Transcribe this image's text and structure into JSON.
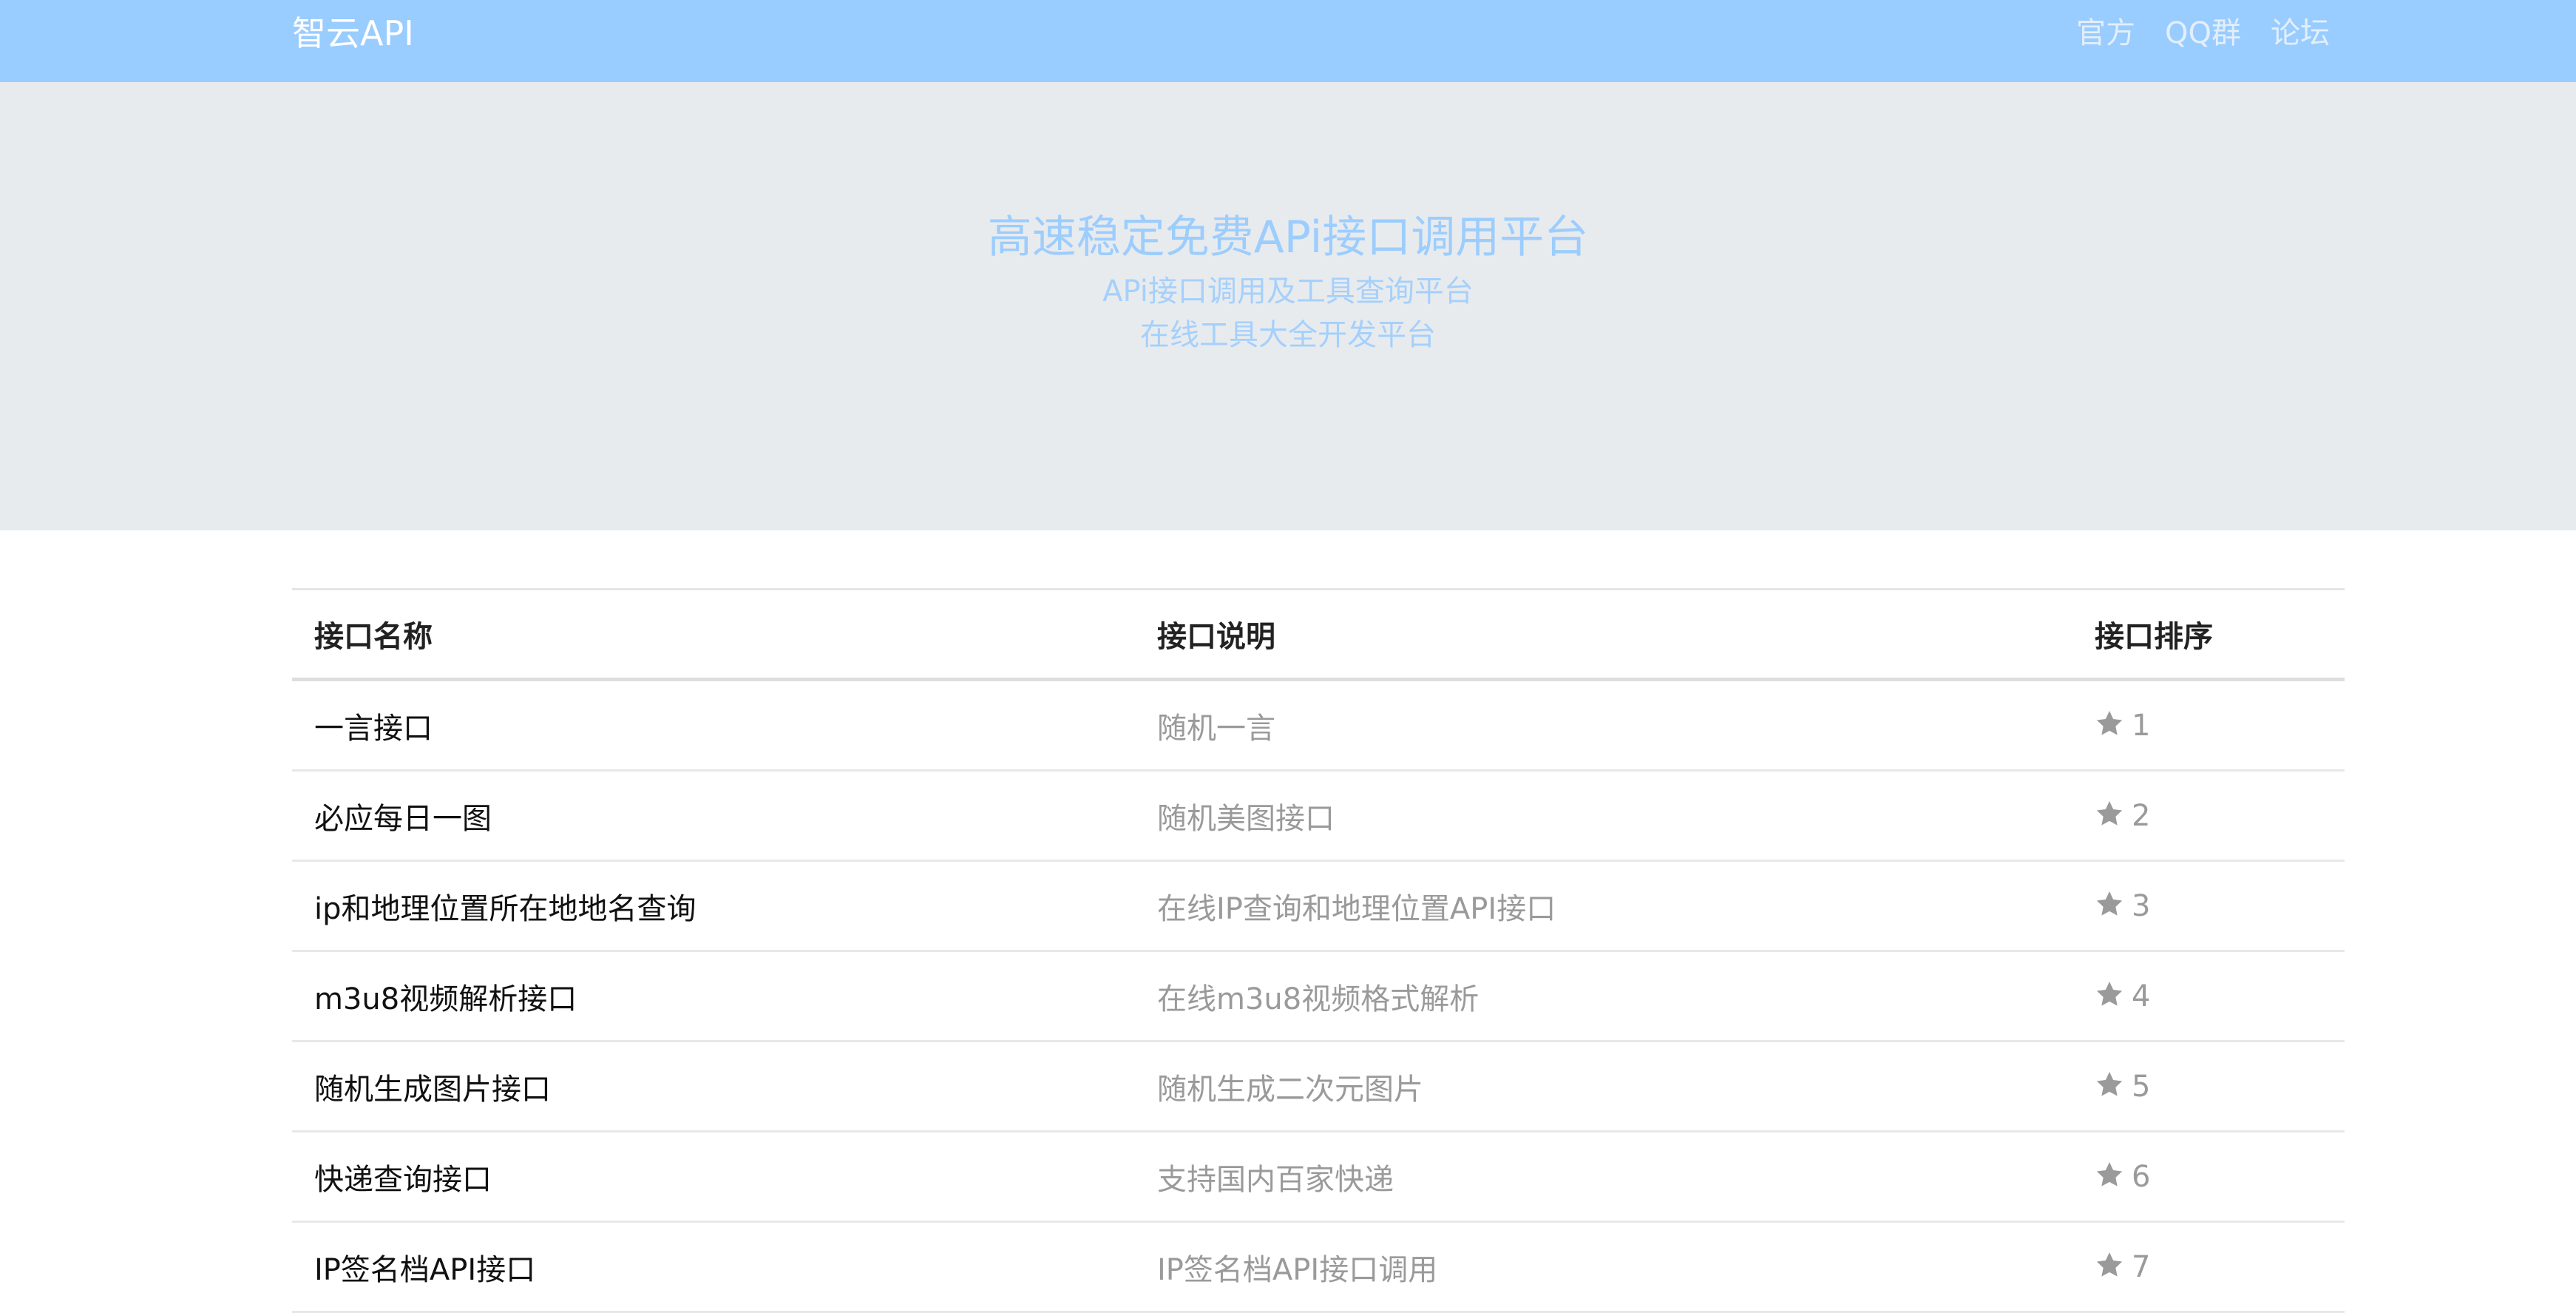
{
  "navbar": {
    "brand": "智云API",
    "links": [
      "官方",
      "QQ群",
      "论坛"
    ]
  },
  "hero": {
    "title": "高速稳定免费APi接口调用平台",
    "subtitle1": "APi接口调用及工具查询平台",
    "subtitle2": "在线工具大全开发平台"
  },
  "table": {
    "headers": [
      "接口名称",
      "接口说明",
      "接口排序"
    ],
    "rows": [
      {
        "name": "一言接口",
        "desc": "随机一言",
        "rank": "1"
      },
      {
        "name": "必应每日一图",
        "desc": "随机美图接口",
        "rank": "2"
      },
      {
        "name": "ip和地理位置所在地地名查询",
        "desc": "在线IP查询和地理位置API接口",
        "rank": "3"
      },
      {
        "name": "m3u8视频解析接口",
        "desc": "在线m3u8视频格式解析",
        "rank": "4"
      },
      {
        "name": "随机生成图片接口",
        "desc": "随机生成二次元图片",
        "rank": "5"
      },
      {
        "name": "快递查询接口",
        "desc": "支持国内百家快递",
        "rank": "6"
      },
      {
        "name": "IP签名档API接口",
        "desc": "IP签名档API接口调用",
        "rank": "7"
      }
    ]
  },
  "icons": {
    "rank": "star-icon"
  },
  "colors": {
    "navbar_bg": "#99ccff",
    "hero_bg": "#e8ebee",
    "hero_text": "#9ccdfd",
    "muted_text": "#9a9a9a"
  }
}
